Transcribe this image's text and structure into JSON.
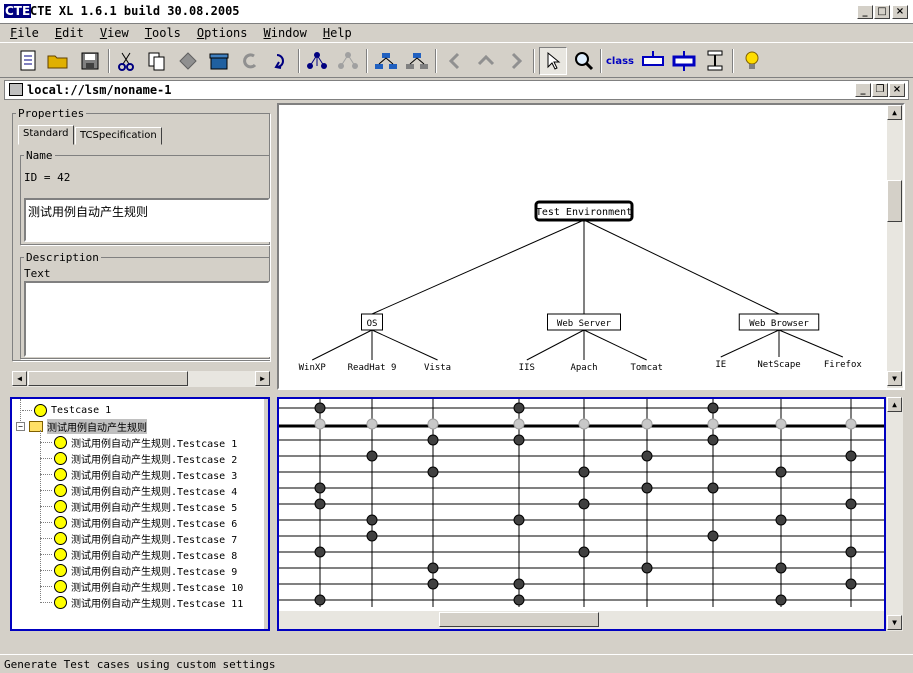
{
  "app": {
    "title": "CTE XL 1.6.1 build 30.08.2005",
    "logo_text": "CTE"
  },
  "menu": [
    "File",
    "Edit",
    "View",
    "Tools",
    "Options",
    "Window",
    "Help"
  ],
  "toolbar": {
    "icons": [
      "new-document-icon",
      "open-folder-icon",
      "save-icon",
      "cut-icon",
      "copy-icon",
      "paste-icon",
      "delete-icon",
      "undo-icon",
      "redo-icon",
      "tree-layout-icon",
      "tree-layout-disabled-icon",
      "expand-tree-icon",
      "collapse-tree-icon",
      "arrow-left-icon",
      "arrow-up-icon",
      "arrow-right-icon",
      "select-pointer-icon",
      "zoom-icon",
      "class-icon",
      "classification-icon",
      "composition-icon",
      "testcase-icon",
      "hint-bulb-icon"
    ],
    "class_label": "class"
  },
  "document": {
    "path": "local://lsm/noname-1"
  },
  "properties": {
    "title": "Properties",
    "tabs": [
      "Standard",
      "TCSpecification"
    ],
    "active_tab": "Standard",
    "name_group": "Name",
    "id_text": "ID = 42",
    "name_value": "测试用例自动产生规则",
    "description_group": "Description",
    "text_label": "Text",
    "text_value": ""
  },
  "tree": {
    "root": "Test Environment",
    "classifications": [
      {
        "name": "OS",
        "classes": [
          "WinXP",
          "ReadHat 9",
          "Vista"
        ]
      },
      {
        "name": "Web Server",
        "classes": [
          "IIS",
          "Apach",
          "Tomcat"
        ]
      },
      {
        "name": "Web Browser",
        "classes": [
          "IE",
          "NetScape",
          "Firefox"
        ]
      }
    ]
  },
  "testcases": {
    "top": "Testcase 1",
    "group": "测试用例自动产生规则",
    "items": [
      "测试用例自动产生规则.Testcase 1",
      "测试用例自动产生规则.Testcase 2",
      "测试用例自动产生规则.Testcase 3",
      "测试用例自动产生规则.Testcase 4",
      "测试用例自动产生规则.Testcase 5",
      "测试用例自动产生规则.Testcase 6",
      "测试用例自动产生规则.Testcase 7",
      "测试用例自动产生规则.Testcase 8",
      "测试用例自动产生规则.Testcase 9",
      "测试用例自动产生规则.Testcase 10",
      "测试用例自动产生规则.Testcase 11"
    ]
  },
  "matrix": {
    "columns": [
      "WinXP",
      "ReadHat 9",
      "Vista",
      "IIS",
      "Apach",
      "Tomcat",
      "IE",
      "NetScape",
      "Firefox"
    ],
    "top_row": [
      1,
      0,
      0,
      1,
      0,
      0,
      1,
      0,
      0
    ],
    "group_row": [
      1,
      1,
      1,
      1,
      1,
      1,
      1,
      1,
      1
    ],
    "rows": [
      [
        0,
        0,
        1,
        1,
        0,
        0,
        1,
        0,
        0
      ],
      [
        0,
        1,
        0,
        0,
        0,
        1,
        0,
        0,
        1
      ],
      [
        0,
        0,
        1,
        0,
        1,
        0,
        0,
        1,
        0
      ],
      [
        1,
        0,
        0,
        0,
        0,
        1,
        1,
        0,
        0
      ],
      [
        1,
        0,
        0,
        0,
        1,
        0,
        0,
        0,
        1
      ],
      [
        0,
        1,
        0,
        1,
        0,
        0,
        0,
        1,
        0
      ],
      [
        0,
        1,
        0,
        0,
        0,
        0,
        1,
        0,
        0
      ],
      [
        1,
        0,
        0,
        0,
        1,
        0,
        0,
        0,
        1
      ],
      [
        0,
        0,
        1,
        0,
        0,
        1,
        0,
        1,
        0
      ],
      [
        0,
        0,
        1,
        1,
        0,
        0,
        0,
        0,
        1
      ],
      [
        1,
        0,
        0,
        1,
        0,
        0,
        0,
        1,
        0
      ]
    ]
  },
  "status": "Generate Test cases using custom settings",
  "colors": {
    "highlight": "#000080",
    "panel_border": "#0000c0",
    "bulb": "#ffff00"
  }
}
